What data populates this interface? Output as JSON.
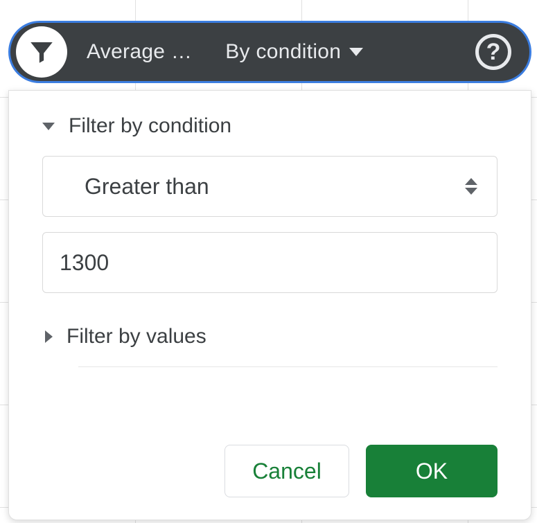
{
  "pill": {
    "column_label": "Average …",
    "mode_label": "By condition"
  },
  "panel": {
    "condition_header": "Filter by condition",
    "condition_operator": "Greater than",
    "condition_value": "1300",
    "values_header": "Filter by values",
    "cancel_label": "Cancel",
    "ok_label": "OK"
  }
}
